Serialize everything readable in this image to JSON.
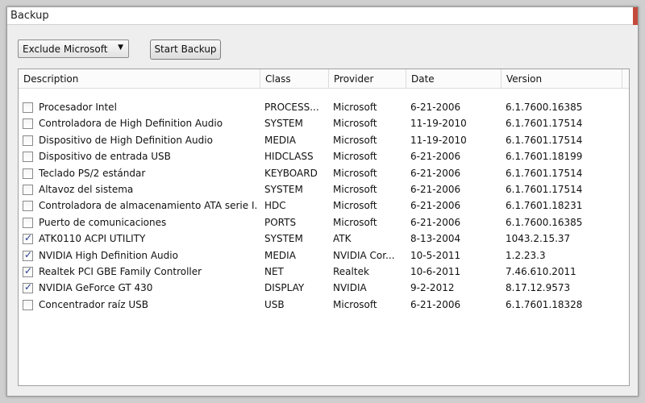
{
  "window": {
    "title": "Backup"
  },
  "toolbar": {
    "filter_value": "Exclude Microsoft",
    "start_label": "Start Backup"
  },
  "columns": {
    "description": "Description",
    "class": "Class",
    "provider": "Provider",
    "date": "Date",
    "version": "Version"
  },
  "rows": [
    {
      "checked": false,
      "description": "Procesador Intel",
      "class": "PROCESS...",
      "provider": "Microsoft",
      "date": "6-21-2006",
      "version": "6.1.7600.16385"
    },
    {
      "checked": false,
      "description": "Controladora de High Definition Audio",
      "class": "SYSTEM",
      "provider": "Microsoft",
      "date": "11-19-2010",
      "version": "6.1.7601.17514"
    },
    {
      "checked": false,
      "description": "Dispositivo de High Definition Audio",
      "class": "MEDIA",
      "provider": "Microsoft",
      "date": "11-19-2010",
      "version": "6.1.7601.17514"
    },
    {
      "checked": false,
      "description": "Dispositivo de entrada USB",
      "class": "HIDCLASS",
      "provider": "Microsoft",
      "date": "6-21-2006",
      "version": "6.1.7601.18199"
    },
    {
      "checked": false,
      "description": "Teclado PS/2 estándar",
      "class": "KEYBOARD",
      "provider": "Microsoft",
      "date": "6-21-2006",
      "version": "6.1.7601.17514"
    },
    {
      "checked": false,
      "description": "Altavoz del sistema",
      "class": "SYSTEM",
      "provider": "Microsoft",
      "date": "6-21-2006",
      "version": "6.1.7601.17514"
    },
    {
      "checked": false,
      "description": "Controladora de almacenamiento ATA serie I...",
      "class": "HDC",
      "provider": "Microsoft",
      "date": "6-21-2006",
      "version": "6.1.7601.18231"
    },
    {
      "checked": false,
      "description": "Puerto de comunicaciones",
      "class": "PORTS",
      "provider": "Microsoft",
      "date": "6-21-2006",
      "version": "6.1.7600.16385"
    },
    {
      "checked": true,
      "description": "ATK0110 ACPI UTILITY",
      "class": "SYSTEM",
      "provider": "ATK",
      "date": "8-13-2004",
      "version": "1043.2.15.37"
    },
    {
      "checked": true,
      "description": "NVIDIA High Definition Audio",
      "class": "MEDIA",
      "provider": "NVIDIA Cor...",
      "date": "10-5-2011",
      "version": "1.2.23.3"
    },
    {
      "checked": true,
      "description": "Realtek PCI GBE Family Controller",
      "class": "NET",
      "provider": "Realtek",
      "date": "10-6-2011",
      "version": "7.46.610.2011"
    },
    {
      "checked": true,
      "description": "NVIDIA GeForce GT 430",
      "class": "DISPLAY",
      "provider": "NVIDIA",
      "date": "9-2-2012",
      "version": "8.17.12.9573"
    },
    {
      "checked": false,
      "description": "Concentrador raíz USB",
      "class": "USB",
      "provider": "Microsoft",
      "date": "6-21-2006",
      "version": "6.1.7601.18328"
    }
  ]
}
